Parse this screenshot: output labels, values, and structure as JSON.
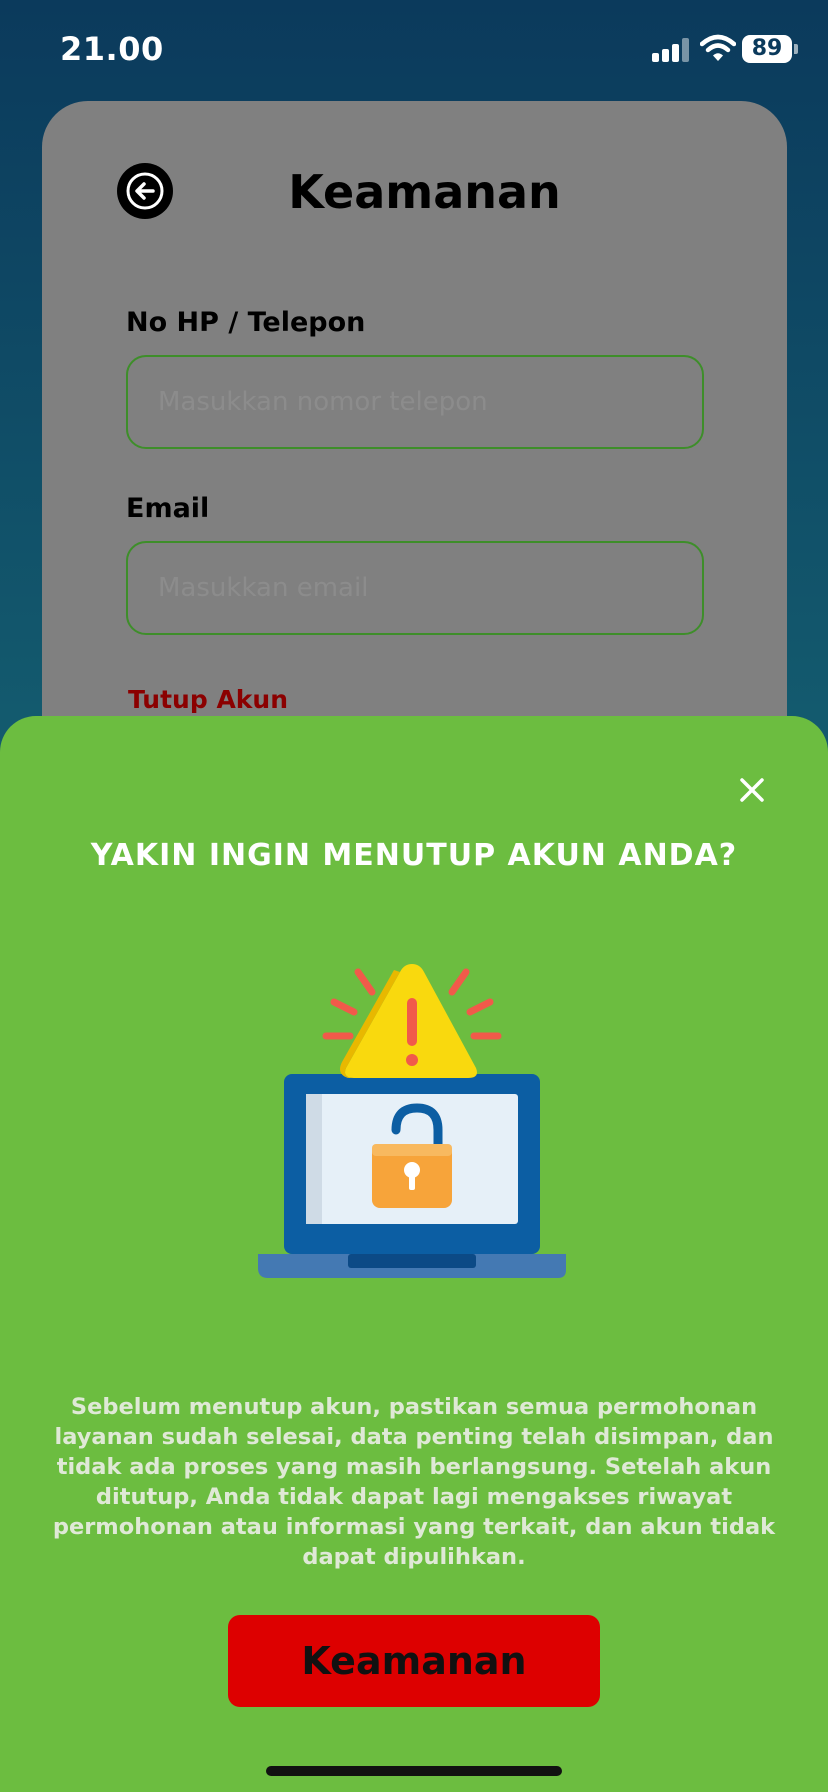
{
  "status_bar": {
    "time": "21.00",
    "battery": "89",
    "icons": [
      "signal-icon",
      "wifi-icon",
      "battery-icon"
    ]
  },
  "page": {
    "title": "Keamanan",
    "back_icon": "arrow-left-icon",
    "phone": {
      "label": "No HP / Telepon",
      "placeholder": "Masukkan nomor telepon",
      "value": ""
    },
    "email": {
      "label": "Email",
      "placeholder": "Masukkan email",
      "value": ""
    },
    "close_account_link": "Tutup Akun"
  },
  "modal": {
    "close_icon": "close-icon",
    "title": "YAKIN INGIN MENUTUP AKUN ANDA?",
    "illustration": "laptop-unlocked-warning-illustration",
    "message": "Sebelum menutup akun, pastikan semua permohonan layanan sudah selesai, data penting telah disimpan, dan tidak ada proses yang masih berlangsung. Setelah akun ditutup, Anda tidak dapat lagi mengakses riwayat permohonan atau informasi yang terkait, dan akun tidak dapat dipulihkan.",
    "confirm_label": "Keamanan"
  },
  "colors": {
    "sheet": "#6cbd40",
    "confirm": "#dd0000",
    "link": "#8b0000",
    "input_border": "#3e8e2a"
  }
}
